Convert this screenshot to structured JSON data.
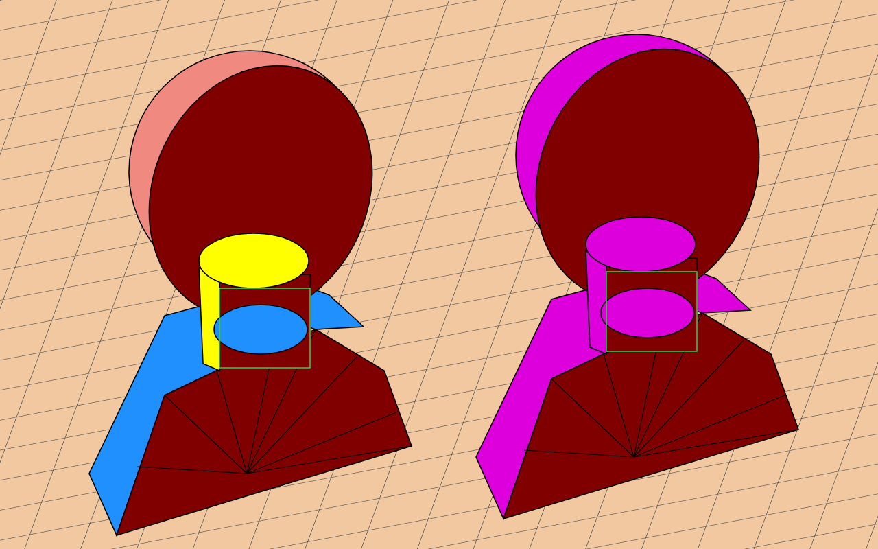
{
  "viewport": {
    "models": [
      {
        "kind": "multicolor",
        "color": "#2090ff"
      },
      {
        "kind": "solid",
        "color": "#dd00dd"
      }
    ]
  }
}
